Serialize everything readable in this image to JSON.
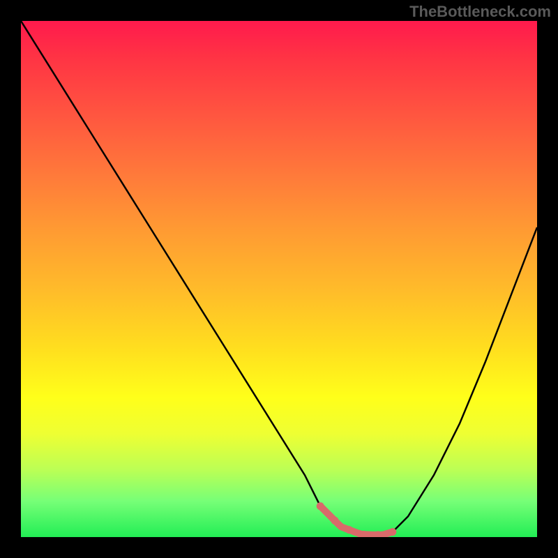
{
  "watermark": "TheBottleneck.com",
  "chart_data": {
    "type": "line",
    "title": "",
    "xlabel": "",
    "ylabel": "",
    "xlim": [
      0,
      100
    ],
    "ylim": [
      0,
      100
    ],
    "x": [
      0,
      5,
      10,
      15,
      20,
      25,
      30,
      35,
      40,
      45,
      50,
      55,
      58,
      62,
      66,
      70,
      72,
      75,
      80,
      85,
      90,
      95,
      100
    ],
    "y": [
      100,
      92,
      84,
      76,
      68,
      60,
      52,
      44,
      36,
      28,
      20,
      12,
      6,
      2,
      0.5,
      0.4,
      1,
      4,
      12,
      22,
      34,
      47,
      60
    ],
    "marker_region_x": [
      58,
      72
    ],
    "marker_color": "#d96a6a",
    "line_color": "#000000",
    "background_gradient_stops": [
      {
        "pos": 0,
        "color": "#ff1a4d"
      },
      {
        "pos": 50,
        "color": "#ffcc22"
      },
      {
        "pos": 100,
        "color": "#22ee55"
      }
    ]
  }
}
